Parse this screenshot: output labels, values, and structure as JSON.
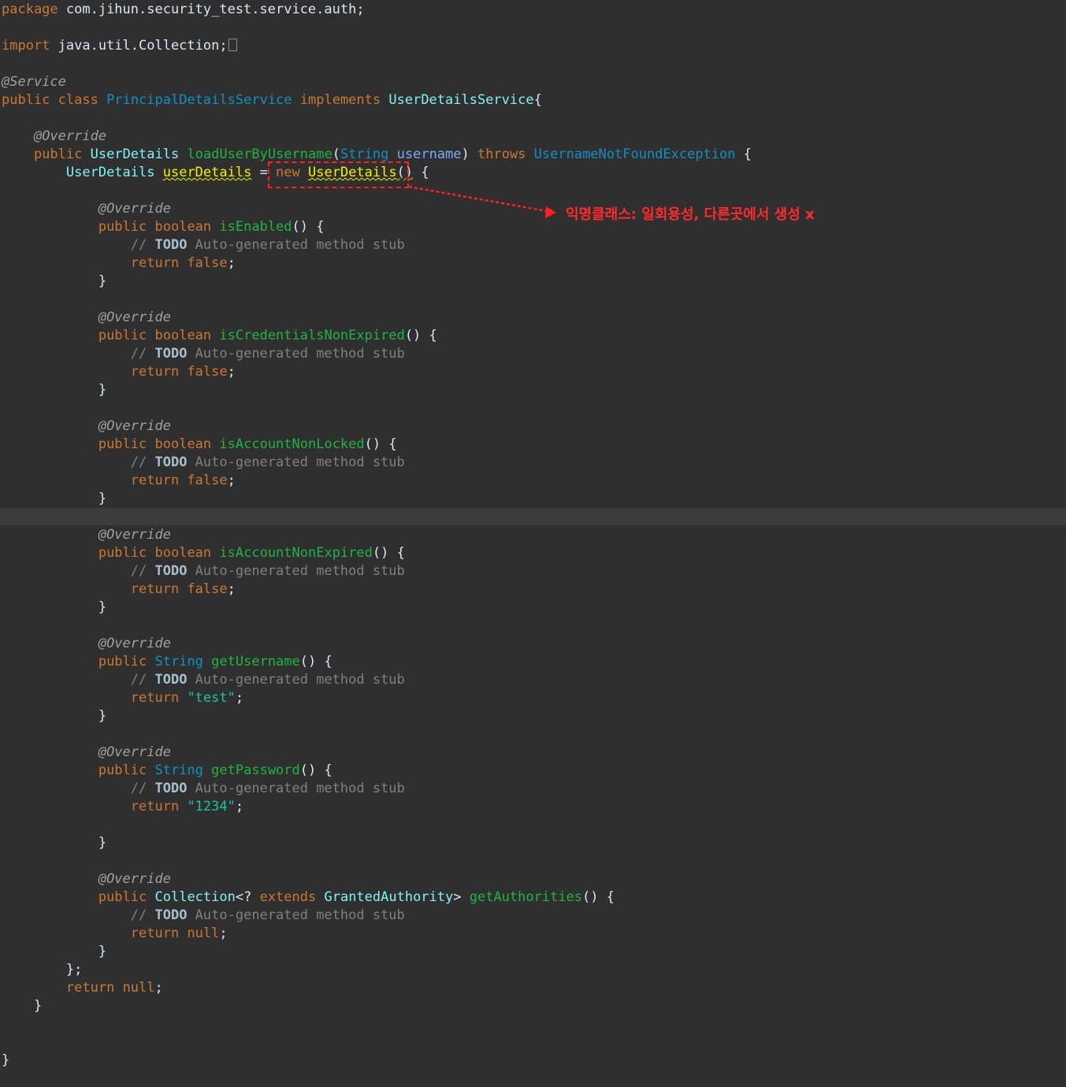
{
  "editor": {
    "theme_colors": {
      "background": "#2f2f2f",
      "current_line": "#3b3b3b",
      "keyword": "#cc7832",
      "annotation": "#a0a0a0",
      "method": "#1eb540",
      "class": "#1290c3",
      "string": "#17c6a3",
      "comment": "#808080"
    },
    "lines": [
      [
        {
          "c": "kw",
          "t": "package"
        },
        {
          "c": "plain",
          "t": " com.jihun.security_test.service.auth;"
        }
      ],
      [],
      [
        {
          "c": "kw",
          "t": "import"
        },
        {
          "c": "plain",
          "t": " java.util.Collection;"
        },
        {
          "c": "fold",
          "t": ""
        }
      ],
      [],
      [
        {
          "c": "ann",
          "t": "@Service"
        }
      ],
      [
        {
          "c": "kw",
          "t": "public"
        },
        {
          "c": "plain",
          "t": " "
        },
        {
          "c": "kw",
          "t": "class"
        },
        {
          "c": "plain",
          "t": " "
        },
        {
          "c": "cls",
          "t": "PrincipalDetailsService"
        },
        {
          "c": "plain",
          "t": " "
        },
        {
          "c": "kw",
          "t": "implements"
        },
        {
          "c": "plain",
          "t": " "
        },
        {
          "c": "type",
          "t": "UserDetailsService"
        },
        {
          "c": "plain",
          "t": "{"
        }
      ],
      [],
      [
        {
          "c": "plain",
          "t": "    "
        },
        {
          "c": "ann",
          "t": "@Override"
        }
      ],
      [
        {
          "c": "plain",
          "t": "    "
        },
        {
          "c": "kw",
          "t": "public"
        },
        {
          "c": "plain",
          "t": " "
        },
        {
          "c": "type",
          "t": "UserDetails"
        },
        {
          "c": "plain",
          "t": " "
        },
        {
          "c": "method",
          "t": "loadUserByUsername"
        },
        {
          "c": "plain",
          "t": "("
        },
        {
          "c": "cls",
          "t": "String"
        },
        {
          "c": "plain",
          "t": " "
        },
        {
          "c": "param",
          "t": "username"
        },
        {
          "c": "plain",
          "t": ") "
        },
        {
          "c": "kw",
          "t": "throws"
        },
        {
          "c": "plain",
          "t": " "
        },
        {
          "c": "cls",
          "t": "UsernameNotFoundException"
        },
        {
          "c": "plain",
          "t": " {"
        }
      ],
      [
        {
          "c": "plain",
          "t": "        "
        },
        {
          "c": "type",
          "t": "UserDetails"
        },
        {
          "c": "plain",
          "t": " "
        },
        {
          "c": "local",
          "t": "userDetails"
        },
        {
          "c": "plain",
          "t": " = "
        },
        {
          "c": "kw",
          "t": "new"
        },
        {
          "c": "plain",
          "t": " "
        },
        {
          "c": "local",
          "t": "UserDetails"
        },
        {
          "c": "warnrefs",
          "t": "()"
        },
        {
          "c": "plain",
          "t": " {"
        }
      ],
      [],
      [
        {
          "c": "plain",
          "t": "            "
        },
        {
          "c": "ann",
          "t": "@Override"
        }
      ],
      [
        {
          "c": "plain",
          "t": "            "
        },
        {
          "c": "kw",
          "t": "public"
        },
        {
          "c": "plain",
          "t": " "
        },
        {
          "c": "kw",
          "t": "boolean"
        },
        {
          "c": "plain",
          "t": " "
        },
        {
          "c": "method",
          "t": "isEnabled"
        },
        {
          "c": "plain",
          "t": "() {"
        }
      ],
      [
        {
          "c": "plain",
          "t": "                "
        },
        {
          "c": "cmt",
          "t": "// "
        },
        {
          "c": "todo",
          "t": "TODO"
        },
        {
          "c": "cmt",
          "t": " Auto-generated method stub"
        }
      ],
      [
        {
          "c": "plain",
          "t": "                "
        },
        {
          "c": "kw",
          "t": "return"
        },
        {
          "c": "plain",
          "t": " "
        },
        {
          "c": "kw",
          "t": "false"
        },
        {
          "c": "plain",
          "t": ";"
        }
      ],
      [
        {
          "c": "plain",
          "t": "            }"
        }
      ],
      [],
      [
        {
          "c": "plain",
          "t": "            "
        },
        {
          "c": "ann",
          "t": "@Override"
        }
      ],
      [
        {
          "c": "plain",
          "t": "            "
        },
        {
          "c": "kw",
          "t": "public"
        },
        {
          "c": "plain",
          "t": " "
        },
        {
          "c": "kw",
          "t": "boolean"
        },
        {
          "c": "plain",
          "t": " "
        },
        {
          "c": "method",
          "t": "isCredentialsNonExpired"
        },
        {
          "c": "plain",
          "t": "() {"
        }
      ],
      [
        {
          "c": "plain",
          "t": "                "
        },
        {
          "c": "cmt",
          "t": "// "
        },
        {
          "c": "todo",
          "t": "TODO"
        },
        {
          "c": "cmt",
          "t": " Auto-generated method stub"
        }
      ],
      [
        {
          "c": "plain",
          "t": "                "
        },
        {
          "c": "kw",
          "t": "return"
        },
        {
          "c": "plain",
          "t": " "
        },
        {
          "c": "kw",
          "t": "false"
        },
        {
          "c": "plain",
          "t": ";"
        }
      ],
      [
        {
          "c": "plain",
          "t": "            }"
        }
      ],
      [],
      [
        {
          "c": "plain",
          "t": "            "
        },
        {
          "c": "ann",
          "t": "@Override"
        }
      ],
      [
        {
          "c": "plain",
          "t": "            "
        },
        {
          "c": "kw",
          "t": "public"
        },
        {
          "c": "plain",
          "t": " "
        },
        {
          "c": "kw",
          "t": "boolean"
        },
        {
          "c": "plain",
          "t": " "
        },
        {
          "c": "method",
          "t": "isAccountNonLocked"
        },
        {
          "c": "plain",
          "t": "() {"
        }
      ],
      [
        {
          "c": "plain",
          "t": "                "
        },
        {
          "c": "cmt",
          "t": "// "
        },
        {
          "c": "todo",
          "t": "TODO"
        },
        {
          "c": "cmt",
          "t": " Auto-generated method stub"
        }
      ],
      [
        {
          "c": "plain",
          "t": "                "
        },
        {
          "c": "kw",
          "t": "return"
        },
        {
          "c": "plain",
          "t": " "
        },
        {
          "c": "kw",
          "t": "false"
        },
        {
          "c": "plain",
          "t": ";"
        }
      ],
      [
        {
          "c": "plain",
          "t": "            }"
        }
      ],
      [],
      [
        {
          "c": "plain",
          "t": "            "
        },
        {
          "c": "ann",
          "t": "@Override"
        }
      ],
      [
        {
          "c": "plain",
          "t": "            "
        },
        {
          "c": "kw",
          "t": "public"
        },
        {
          "c": "plain",
          "t": " "
        },
        {
          "c": "kw",
          "t": "boolean"
        },
        {
          "c": "plain",
          "t": " "
        },
        {
          "c": "method",
          "t": "isAccountNonExpired"
        },
        {
          "c": "plain",
          "t": "() {"
        }
      ],
      [
        {
          "c": "plain",
          "t": "                "
        },
        {
          "c": "cmt",
          "t": "// "
        },
        {
          "c": "todo",
          "t": "TODO"
        },
        {
          "c": "cmt",
          "t": " Auto-generated method stub"
        }
      ],
      [
        {
          "c": "plain",
          "t": "                "
        },
        {
          "c": "kw",
          "t": "return"
        },
        {
          "c": "plain",
          "t": " "
        },
        {
          "c": "kw",
          "t": "false"
        },
        {
          "c": "plain",
          "t": ";"
        }
      ],
      [
        {
          "c": "plain",
          "t": "            }"
        }
      ],
      [],
      [
        {
          "c": "plain",
          "t": "            "
        },
        {
          "c": "ann",
          "t": "@Override"
        }
      ],
      [
        {
          "c": "plain",
          "t": "            "
        },
        {
          "c": "kw",
          "t": "public"
        },
        {
          "c": "plain",
          "t": " "
        },
        {
          "c": "cls",
          "t": "String"
        },
        {
          "c": "plain",
          "t": " "
        },
        {
          "c": "method",
          "t": "getUsername"
        },
        {
          "c": "plain",
          "t": "() {"
        }
      ],
      [
        {
          "c": "plain",
          "t": "                "
        },
        {
          "c": "cmt",
          "t": "// "
        },
        {
          "c": "todo",
          "t": "TODO"
        },
        {
          "c": "cmt",
          "t": " Auto-generated method stub"
        }
      ],
      [
        {
          "c": "plain",
          "t": "                "
        },
        {
          "c": "kw",
          "t": "return"
        },
        {
          "c": "plain",
          "t": " "
        },
        {
          "c": "str",
          "t": "\"test\""
        },
        {
          "c": "plain",
          "t": ";"
        }
      ],
      [
        {
          "c": "plain",
          "t": "            }"
        }
      ],
      [],
      [
        {
          "c": "plain",
          "t": "            "
        },
        {
          "c": "ann",
          "t": "@Override"
        }
      ],
      [
        {
          "c": "plain",
          "t": "            "
        },
        {
          "c": "kw",
          "t": "public"
        },
        {
          "c": "plain",
          "t": " "
        },
        {
          "c": "cls",
          "t": "String"
        },
        {
          "c": "plain",
          "t": " "
        },
        {
          "c": "method",
          "t": "getPassword"
        },
        {
          "c": "plain",
          "t": "() {"
        }
      ],
      [
        {
          "c": "plain",
          "t": "                "
        },
        {
          "c": "cmt",
          "t": "// "
        },
        {
          "c": "todo",
          "t": "TODO"
        },
        {
          "c": "cmt",
          "t": " Auto-generated method stub"
        }
      ],
      [
        {
          "c": "plain",
          "t": "                "
        },
        {
          "c": "kw",
          "t": "return"
        },
        {
          "c": "plain",
          "t": " "
        },
        {
          "c": "str",
          "t": "\"1234\""
        },
        {
          "c": "plain",
          "t": ";"
        }
      ],
      [],
      [
        {
          "c": "plain",
          "t": "            }"
        }
      ],
      [],
      [
        {
          "c": "plain",
          "t": "            "
        },
        {
          "c": "ann",
          "t": "@Override"
        }
      ],
      [
        {
          "c": "plain",
          "t": "            "
        },
        {
          "c": "kw",
          "t": "public"
        },
        {
          "c": "plain",
          "t": " "
        },
        {
          "c": "type",
          "t": "Collection"
        },
        {
          "c": "plain",
          "t": "<? "
        },
        {
          "c": "kw",
          "t": "extends"
        },
        {
          "c": "plain",
          "t": " "
        },
        {
          "c": "type",
          "t": "GrantedAuthority"
        },
        {
          "c": "plain",
          "t": "> "
        },
        {
          "c": "method",
          "t": "getAuthorities"
        },
        {
          "c": "plain",
          "t": "() {"
        }
      ],
      [
        {
          "c": "plain",
          "t": "                "
        },
        {
          "c": "cmt",
          "t": "// "
        },
        {
          "c": "todo",
          "t": "TODO"
        },
        {
          "c": "cmt",
          "t": " Auto-generated method stub"
        }
      ],
      [
        {
          "c": "plain",
          "t": "                "
        },
        {
          "c": "kw",
          "t": "return"
        },
        {
          "c": "plain",
          "t": " "
        },
        {
          "c": "kw",
          "t": "null"
        },
        {
          "c": "plain",
          "t": ";"
        }
      ],
      [
        {
          "c": "plain",
          "t": "            }"
        }
      ],
      [
        {
          "c": "plain",
          "t": "        };"
        }
      ],
      [
        {
          "c": "plain",
          "t": "        "
        },
        {
          "c": "kw",
          "t": "return"
        },
        {
          "c": "plain",
          "t": " "
        },
        {
          "c": "kw",
          "t": "null"
        },
        {
          "c": "plain",
          "t": ";"
        }
      ],
      [
        {
          "c": "plain",
          "t": "    }"
        }
      ],
      [],
      [],
      [
        {
          "c": "plain",
          "t": "}"
        }
      ]
    ]
  },
  "annotation": {
    "text": "익명클래스: 일회용성, 다른곳에서 생성 x",
    "color": "#ff2020"
  }
}
